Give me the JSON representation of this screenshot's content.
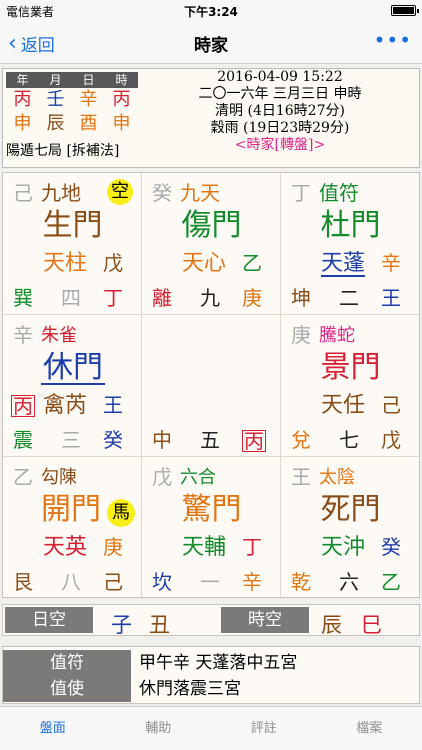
{
  "status_bar": {
    "carrier": "電信業者",
    "time": "下午3:24",
    "wifi_icon": "wifi-icon",
    "battery_icon": "battery-icon"
  },
  "nav": {
    "back_label": "返回",
    "title": "時家",
    "more_label": "•••"
  },
  "info": {
    "pillar_headers": [
      "年",
      "月",
      "日",
      "時"
    ],
    "stems": [
      "丙",
      "壬",
      "辛",
      "丙"
    ],
    "branches": [
      "申",
      "辰",
      "酉",
      "申"
    ],
    "ju": "陽遁七局 [拆補法]",
    "datetime": "2016-04-09 15:22",
    "lunar": "二〇一六年 三月三日 申時",
    "term1": "清明 (4日16時27分)",
    "term2": "穀雨 (19日23時29分)",
    "link": "<時家[轉盤]>"
  },
  "cells": [
    {
      "stem": "己",
      "deity": "九地",
      "badge": "空",
      "door": "生門",
      "star": "天柱",
      "star_r": "戊",
      "gua": "巽",
      "num": "四",
      "stem_b": "丁"
    },
    {
      "stem": "癸",
      "deity": "九天",
      "door": "傷門",
      "star": "天心",
      "star_r": "乙",
      "gua": "離",
      "num": "九",
      "stem_b": "庚"
    },
    {
      "stem": "丁",
      "deity": "值符",
      "door": "杜門",
      "star": "天蓬",
      "star_r": "辛",
      "gua": "坤",
      "num": "二",
      "stem_b": "王"
    },
    {
      "stem": "辛",
      "deity": "朱雀",
      "door": "休門",
      "stem_mid": "丙",
      "star": "禽芮",
      "star_r": "王",
      "gua": "震",
      "num": "三",
      "stem_b": "癸"
    },
    {
      "gua": "中",
      "num": "五",
      "stem_b": "丙"
    },
    {
      "stem": "庚",
      "deity": "騰蛇",
      "door": "景門",
      "star": "天任",
      "star_r": "己",
      "gua": "兌",
      "num": "七",
      "stem_b": "戊"
    },
    {
      "stem": "乙",
      "deity": "勾陳",
      "door": "開門",
      "badge": "馬",
      "star": "天英",
      "star_r": "庚",
      "gua": "艮",
      "num": "八",
      "stem_b": "己"
    },
    {
      "stem": "戊",
      "deity": "六合",
      "door": "驚門",
      "star": "天輔",
      "star_r": "丁",
      "gua": "坎",
      "num": "一",
      "stem_b": "辛"
    },
    {
      "stem": "王",
      "deity": "太陰",
      "door": "死門",
      "star": "天沖",
      "star_r": "癸",
      "gua": "乾",
      "num": "六",
      "stem_b": "乙"
    }
  ],
  "empties": {
    "day_label": "日空",
    "day_1": "子",
    "day_2": "丑",
    "hour_label": "時空",
    "hour_1": "辰",
    "hour_2": "巳"
  },
  "footer": {
    "zhifu_label": "值符",
    "zhifu_text": "甲午辛  天蓬落中五宮",
    "zhishi_label": "值使",
    "zhishi_text": "休門落震三宮"
  },
  "tabs": [
    "盤面",
    "輔助",
    "評註",
    "檔案"
  ],
  "colors": {
    "accent": "#1a6fe0",
    "badge": "#f7ee1a",
    "red": "#d61f32",
    "green": "#128b2a",
    "orange": "#e27614",
    "blue": "#1d3eaa",
    "brown": "#8a4d17",
    "magenta": "#e0238a"
  }
}
